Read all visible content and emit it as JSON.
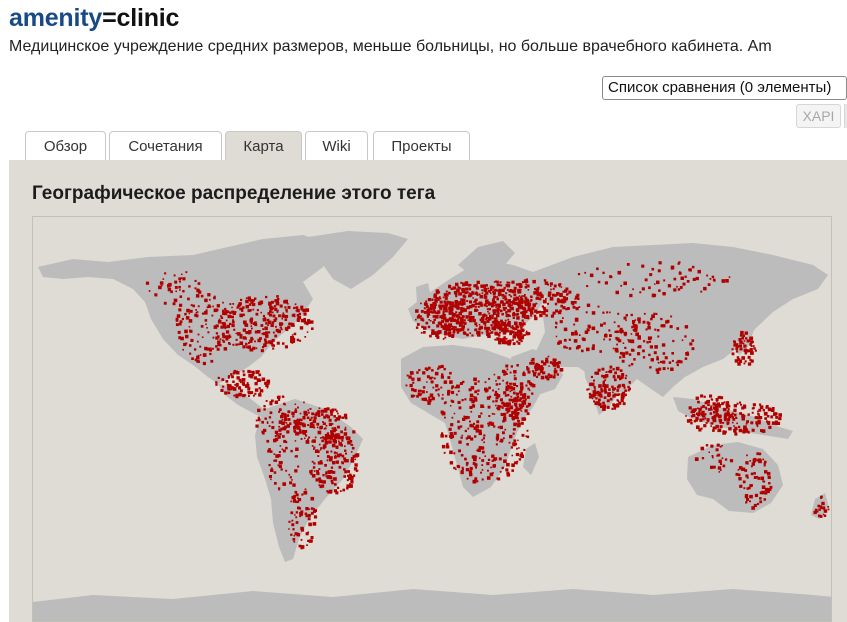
{
  "header": {
    "tag_key": "amenity",
    "tag_eq": "=",
    "tag_value": "clinic",
    "description": "Медицинское учреждение средних размеров, меньше больницы, но больше врачебного кабинета. Am"
  },
  "toolbar": {
    "compare_list": "Список сравнения (0 элементы)",
    "xapi_label": "XAPI"
  },
  "tabs": [
    {
      "label": "Обзор",
      "active": false
    },
    {
      "label": "Сочетания",
      "active": false
    },
    {
      "label": "Карта",
      "active": true
    },
    {
      "label": "Wiki",
      "active": false
    },
    {
      "label": "Проекты",
      "active": false
    }
  ],
  "panel": {
    "title": "Географическое распределение этого тега"
  },
  "map": {
    "colors": {
      "land": "#bcbcbc",
      "water": "#dedcd4",
      "points": "#b00000"
    }
  }
}
